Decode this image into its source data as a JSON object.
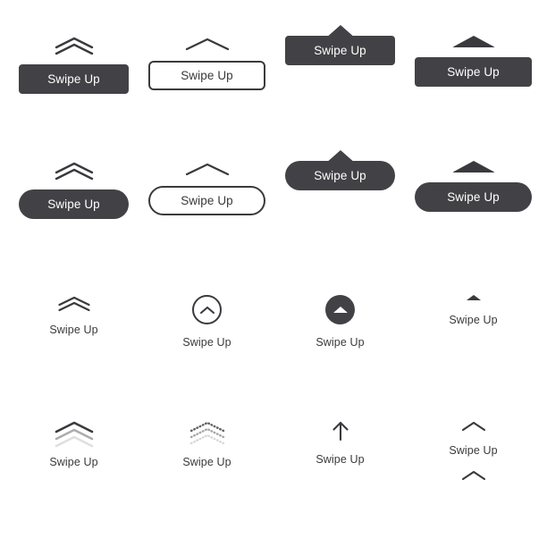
{
  "page": {
    "background_color": "#ffffff",
    "accent_dark": "#424246",
    "stroke_dark": "#3a3a3e",
    "label_color": "#3a3a3e",
    "button_text_color": "#ffffff"
  },
  "rows": [
    {
      "name": "rectangular-buttons",
      "items": [
        {
          "id": "r1c1",
          "label": "Swipe Up",
          "style": "solid-rect",
          "icon": "double-chevron-up-icon"
        },
        {
          "id": "r1c2",
          "label": "Swipe Up",
          "style": "outline-rect",
          "icon": "single-chevron-up-icon"
        },
        {
          "id": "r1c3",
          "label": "Swipe Up",
          "style": "solid-rect-notch",
          "icon": "notch-triangle-up-icon"
        },
        {
          "id": "r1c4",
          "label": "Swipe Up",
          "style": "solid-rect",
          "icon": "flat-triangle-up-icon"
        }
      ]
    },
    {
      "name": "pill-buttons",
      "items": [
        {
          "id": "r2c1",
          "label": "Swipe Up",
          "style": "solid-pill",
          "icon": "double-chevron-up-icon"
        },
        {
          "id": "r2c2",
          "label": "Swipe Up",
          "style": "outline-pill",
          "icon": "single-chevron-up-icon"
        },
        {
          "id": "r2c3",
          "label": "Swipe Up",
          "style": "solid-pill-notch",
          "icon": "notch-triangle-up-icon"
        },
        {
          "id": "r2c4",
          "label": "Swipe Up",
          "style": "solid-pill",
          "icon": "flat-triangle-up-icon"
        }
      ]
    },
    {
      "name": "icon-with-caption",
      "items": [
        {
          "id": "r3c1",
          "label": "Swipe Up",
          "style": "icon-only",
          "icon": "double-chevron-up-icon"
        },
        {
          "id": "r3c2",
          "label": "Swipe Up",
          "style": "icon-only",
          "icon": "circle-outline-chevron-up-icon"
        },
        {
          "id": "r3c3",
          "label": "Swipe Up",
          "style": "icon-only",
          "icon": "circle-filled-triangle-up-icon"
        },
        {
          "id": "r3c4",
          "label": "Swipe Up",
          "style": "icon-only",
          "icon": "small-triangle-up-icon"
        }
      ]
    },
    {
      "name": "animated-icon-variants",
      "items": [
        {
          "id": "r4c1",
          "label": "Swipe Up",
          "style": "icon-only",
          "icon": "triple-chevron-fade-up-icon"
        },
        {
          "id": "r4c2",
          "label": "Swipe Up",
          "style": "icon-only",
          "icon": "dotted-chevron-up-icon"
        },
        {
          "id": "r4c3",
          "label": "Swipe Up",
          "style": "icon-only",
          "icon": "arrow-up-icon"
        },
        {
          "id": "r4c4",
          "label": "Swipe Up",
          "style": "icon-only",
          "icon": "chevron-up-above-and-below-icon"
        }
      ]
    }
  ]
}
